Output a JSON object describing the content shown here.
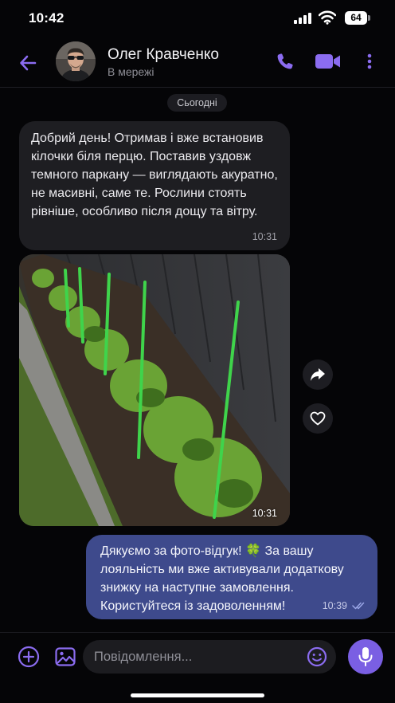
{
  "status_bar": {
    "time": "10:42",
    "battery": "64"
  },
  "header": {
    "name": "Олег Кравченко",
    "status": "В мережі"
  },
  "chat": {
    "date": "Сьогодні",
    "messages": [
      {
        "text": "Добрий день! Отримав і вже встановив кілочки біля перцю. Поставив уздовж темного паркану — виглядають акуратно, не масивні, саме те. Рослини стоять рівніше, особливо після дощу та вітру.",
        "time": "10:31"
      },
      {
        "time": "10:31"
      },
      {
        "text": "Дякуємо за фото-відгук! 🍀 За вашу лояльність ми вже активували додаткову знижку на наступне замовлення. Користуйтеся із задоволенням!",
        "time": "10:39"
      }
    ]
  },
  "composer": {
    "placeholder": "Повідомлення..."
  },
  "colors": {
    "accent": "#8b6cf0",
    "outgoing_bubble": "#3e4a8c",
    "incoming_bubble": "#1e1e22",
    "mic_button": "#7a5fe3"
  },
  "icons": [
    "back-arrow-icon",
    "phone-icon",
    "video-camera-icon",
    "more-vertical-icon",
    "share-icon",
    "heart-icon",
    "plus-circle-icon",
    "gallery-icon",
    "emoji-icon",
    "microphone-icon",
    "double-check-icon"
  ]
}
